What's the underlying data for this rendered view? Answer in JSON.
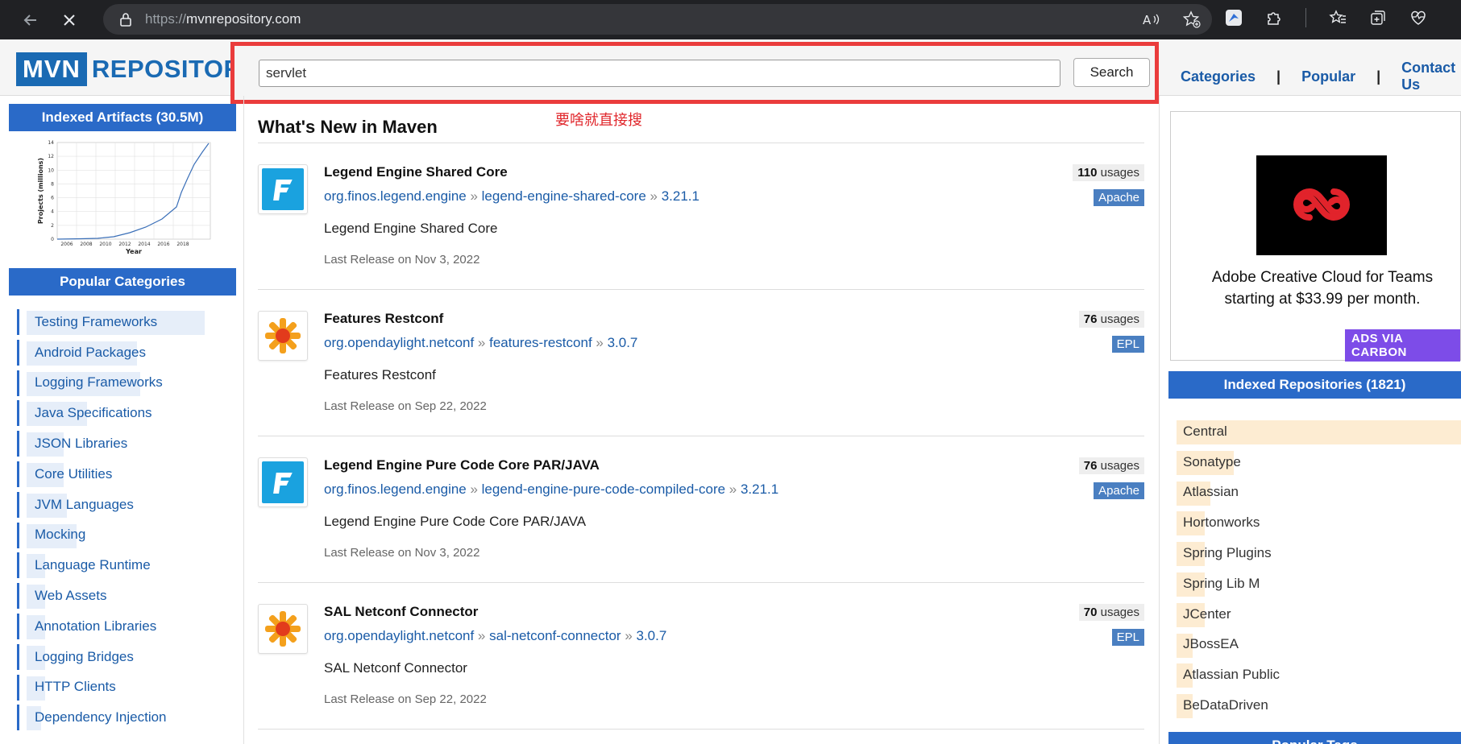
{
  "browser": {
    "url_protocol": "https://",
    "url_host": "mvnrepository.com"
  },
  "site": {
    "logo_mvn": "MVN",
    "logo_repo": "REPOSITORY",
    "brand_color": "#1a6ab3"
  },
  "search": {
    "value": "servlet",
    "button": "Search"
  },
  "nav": {
    "categories": "Categories",
    "popular": "Popular",
    "contact": "Contact Us"
  },
  "annotation": "要啥就直接搜",
  "left": {
    "indexed_header": "Indexed Artifacts (30.5M)",
    "chart": {
      "ylabel": "Projects (millions)",
      "xlabel": "Year",
      "xticks": [
        "2006",
        "2008",
        "2010",
        "2012",
        "2014",
        "2016",
        "2018"
      ],
      "yticks": [
        "0",
        "2",
        "4",
        "6",
        "8",
        "10",
        "12",
        "14"
      ]
    },
    "categories_header": "Popular Categories",
    "categories": [
      {
        "label": "Testing Frameworks",
        "share": 0.97
      },
      {
        "label": "Android Packages",
        "share": 0.6
      },
      {
        "label": "Logging Frameworks",
        "share": 0.62
      },
      {
        "label": "Java Specifications",
        "share": 0.33
      },
      {
        "label": "JSON Libraries",
        "share": 0.2
      },
      {
        "label": "Core Utilities",
        "share": 0.2
      },
      {
        "label": "JVM Languages",
        "share": 0.22
      },
      {
        "label": "Mocking",
        "share": 0.27
      },
      {
        "label": "Language Runtime",
        "share": 0.1
      },
      {
        "label": "Web Assets",
        "share": 0.1
      },
      {
        "label": "Annotation Libraries",
        "share": 0.1
      },
      {
        "label": "Logging Bridges",
        "share": 0.1
      },
      {
        "label": "HTTP Clients",
        "share": 0.1
      },
      {
        "label": "Dependency Injection",
        "share": 0.08
      }
    ]
  },
  "main": {
    "heading": "What's New in Maven",
    "artifacts": [
      {
        "title": "Legend Engine Shared Core",
        "group": "org.finos.legend.engine",
        "artifact": "legend-engine-shared-core",
        "version": "3.21.1",
        "description": "Legend Engine Shared Core",
        "release": "Last Release on Nov 3, 2022",
        "usages_count": "110",
        "usages_label": "usages",
        "license": "Apache",
        "icon": "finos-icon"
      },
      {
        "title": "Features Restconf",
        "group": "org.opendaylight.netconf",
        "artifact": "features-restconf",
        "version": "3.0.7",
        "description": "Features Restconf",
        "release": "Last Release on Sep 22, 2022",
        "usages_count": "76",
        "usages_label": "usages",
        "license": "EPL",
        "icon": "opendaylight-icon"
      },
      {
        "title": "Legend Engine Pure Code Core PAR/JAVA",
        "group": "org.finos.legend.engine",
        "artifact": "legend-engine-pure-code-compiled-core",
        "version": "3.21.1",
        "description": "Legend Engine Pure Code Core PAR/JAVA",
        "release": "Last Release on Nov 3, 2022",
        "usages_count": "76",
        "usages_label": "usages",
        "license": "Apache",
        "icon": "finos-icon"
      },
      {
        "title": "SAL Netconf Connector",
        "group": "org.opendaylight.netconf",
        "artifact": "sal-netconf-connector",
        "version": "3.0.7",
        "description": "SAL Netconf Connector",
        "release": "Last Release on Sep 22, 2022",
        "usages_count": "70",
        "usages_label": "usages",
        "license": "EPL",
        "icon": "opendaylight-icon"
      }
    ]
  },
  "right": {
    "ad_text_1": "Adobe Creative Cloud for Teams",
    "ad_text_2": "starting at $33.99 per month.",
    "ad_badge": "ADS VIA CARBON",
    "repos_header": "Indexed Repositories (1821)",
    "repos": [
      {
        "label": "Central",
        "share": 1.0
      },
      {
        "label": "Sonatype",
        "share": 0.2
      },
      {
        "label": "Atlassian",
        "share": 0.12
      },
      {
        "label": "Hortonworks",
        "share": 0.1
      },
      {
        "label": "Spring Plugins",
        "share": 0.1
      },
      {
        "label": "Spring Lib M",
        "share": 0.1
      },
      {
        "label": "JCenter",
        "share": 0.1
      },
      {
        "label": "JBossEA",
        "share": 0.05
      },
      {
        "label": "Atlassian Public",
        "share": 0.05
      },
      {
        "label": "BeDataDriven",
        "share": 0.03
      }
    ],
    "popular_tags_header": "Popular Tags"
  }
}
